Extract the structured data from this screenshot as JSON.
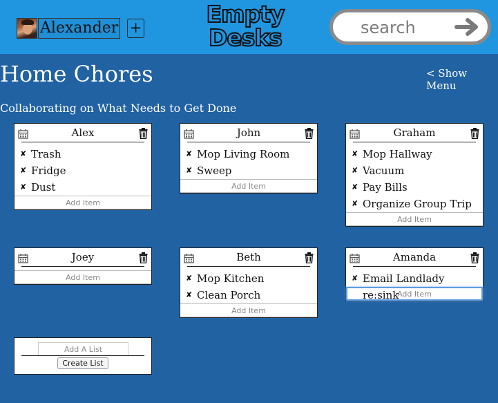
{
  "header": {
    "username": "Alexander",
    "add_label": "+",
    "logo_line1": "Empty",
    "logo_line2": "Desks",
    "search_placeholder": "search"
  },
  "page": {
    "title": "Home Chores",
    "show_menu": "< Show Menu",
    "subtitle": "Collaborating on What Needs to Get Done"
  },
  "lists": [
    {
      "name": "Alex",
      "items": [
        "Trash",
        "Fridge",
        "Dust"
      ]
    },
    {
      "name": "John",
      "items": [
        "Mop Living Room",
        "Sweep"
      ]
    },
    {
      "name": "Graham",
      "items": [
        "Mop Hallway",
        "Vacuum",
        "Pay Bills",
        "Organize Group Trip"
      ]
    },
    {
      "name": "Joey",
      "items": []
    },
    {
      "name": "Beth",
      "items": [
        "Mop Kitchen",
        "Clean Porch"
      ]
    },
    {
      "name": "Amanda",
      "items": [
        "Email Landlady re:sink"
      ]
    }
  ],
  "add_item_placeholder": "Add Item",
  "new_list": {
    "placeholder": "Add A List",
    "button": "Create List"
  },
  "icons": {
    "avatar": "user-avatar",
    "search": "arrow-right-icon",
    "calendar": "calendar-icon",
    "trash": "trash-icon",
    "remove": "x-icon"
  },
  "colors": {
    "header_bg": "#2196e0",
    "page_bg": "#2162a3",
    "focus": "#5a9be3"
  }
}
